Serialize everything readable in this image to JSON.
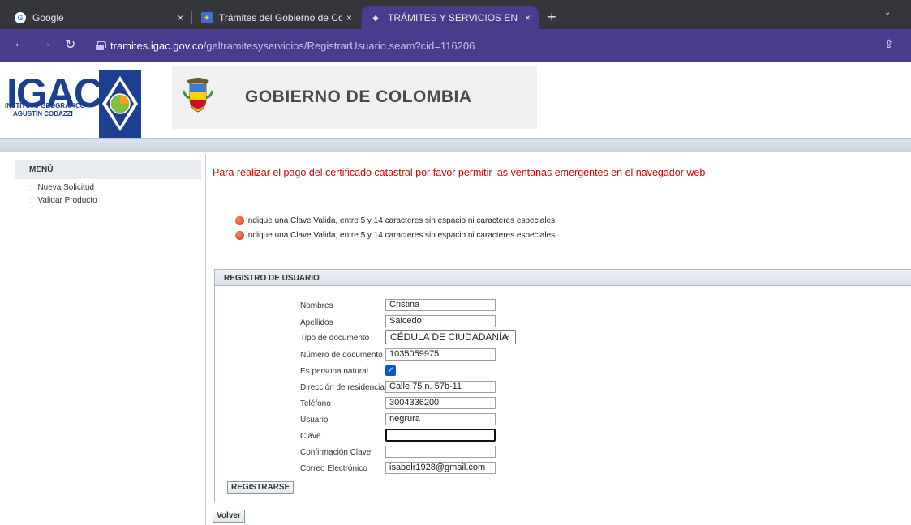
{
  "browser": {
    "tabs": [
      {
        "title": "Google",
        "close": "×"
      },
      {
        "title": "Trámites del Gobierno de Colomb",
        "close": "×"
      },
      {
        "title": "TRÁMITES Y SERVICIOS EN LÍNEA",
        "close": "×"
      }
    ],
    "new_tab": "+",
    "tab_dropdown": "⌄",
    "url_host": "tramites.igac.gov.co",
    "url_path": "/geltramitesyservicios/RegistrarUsuario.seam?cid=116206",
    "share": "⇪"
  },
  "header": {
    "igac": "IGAC",
    "igac_line1": "INSTITUTO GEOGRÁFICO",
    "igac_line2": "AGUSTÍN CODAZZI",
    "gov_title": "GOBIERNO DE COLOMBIA"
  },
  "sidebar": {
    "title": "MENÚ",
    "items": [
      {
        "label": "Nueva Solicitud"
      },
      {
        "label": "Validar Producto"
      }
    ]
  },
  "notice": "Para realizar el pago del certificado catastral por favor permitir las ventanas emergentes en el navegador web",
  "errors": [
    "Indique una Clave Valida, entre 5 y 14 caracteres sin espacio ni caracteres especiales",
    "Indique una Clave Valida, entre 5 y 14 caracteres sin espacio ni caracteres especiales"
  ],
  "form": {
    "title": "REGISTRO DE USUARIO",
    "nombres_label": "Nombres",
    "nombres_value": "Cristina",
    "apellidos_label": "Apellidos",
    "apellidos_value": "Salcedo",
    "tipo_doc_label": "Tipo de documento",
    "tipo_doc_value": "CÉDULA DE CIUDADANÍA",
    "num_doc_label": "Número de documento",
    "num_doc_value": "1035059975",
    "persona_label": "Es persona natural",
    "persona_checked": true,
    "direccion_label": "Dirección de residencia",
    "direccion_value": "Calle 75 n. 57b-11",
    "telefono_label": "Teléfono",
    "telefono_value": "3004336200",
    "usuario_label": "Usuario",
    "usuario_value": "negrura",
    "clave_label": "Clave",
    "clave_value": "",
    "confirm_label": "Confirmación Clave",
    "confirm_value": "",
    "correo_label": "Correo Electrónico",
    "correo_value": "isabelr1928@gmail.com",
    "submit": "REGISTRARSE",
    "back": "Volver"
  }
}
